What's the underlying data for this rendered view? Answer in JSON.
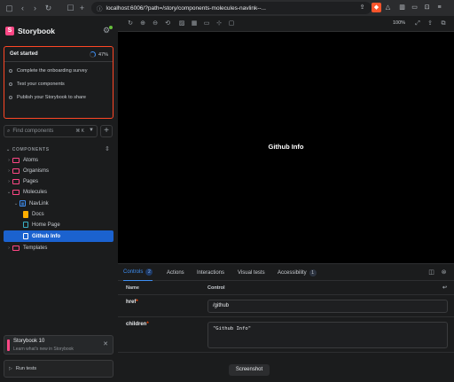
{
  "browser": {
    "url": "localhost:6006/?path=/story/components-molecules-navlink--...",
    "zoom": "100%"
  },
  "sidebar": {
    "title": "Storybook",
    "logo_letter": "S",
    "onboarding": {
      "title": "Get started",
      "progress": "47%",
      "progress_fraction": 0.47,
      "tasks": [
        "Complete the onboarding survey",
        "Test your components",
        "Publish your Storybook to share"
      ]
    },
    "search_placeholder": "Find components",
    "search_shortcut": "⌘ K",
    "section_title": "COMPONENTS",
    "tree": [
      {
        "label": "Atoms",
        "type": "folder",
        "depth": 0,
        "expanded": false
      },
      {
        "label": "Organisms",
        "type": "folder",
        "depth": 0,
        "expanded": false
      },
      {
        "label": "Pages",
        "type": "folder",
        "depth": 0,
        "expanded": false
      },
      {
        "label": "Molecules",
        "type": "folder",
        "depth": 0,
        "expanded": true
      },
      {
        "label": "NavLink",
        "type": "component",
        "depth": 1,
        "expanded": true
      },
      {
        "label": "Docs",
        "type": "docs",
        "depth": 2
      },
      {
        "label": "Home Page",
        "type": "story",
        "depth": 2
      },
      {
        "label": "Github Info",
        "type": "story",
        "depth": 2,
        "selected": true
      },
      {
        "label": "Templates",
        "type": "folder",
        "depth": 0,
        "expanded": false
      }
    ],
    "whats_new": {
      "title": "Storybook 10",
      "subtitle": "Learn what's new in Storybook"
    },
    "run_tests": "Run tests"
  },
  "preview": {
    "text": "Github Info"
  },
  "addons": {
    "tabs": [
      {
        "label": "Controls",
        "badge": "2",
        "active": true
      },
      {
        "label": "Actions"
      },
      {
        "label": "Interactions"
      },
      {
        "label": "Visual tests"
      },
      {
        "label": "Accessibility",
        "badge": "1"
      }
    ],
    "columns": {
      "name": "Name",
      "control": "Control"
    },
    "rows": [
      {
        "name": "href",
        "required": "*",
        "value": "/github"
      },
      {
        "name": "children",
        "required": "*",
        "value": "\"Github Info\""
      }
    ]
  },
  "screenshot_button": "Screenshot",
  "colors": {
    "accent": "#3e8ff4",
    "brand": "#ff4785",
    "selected": "#1b62cf",
    "onboarding_border": "#ff4725"
  }
}
